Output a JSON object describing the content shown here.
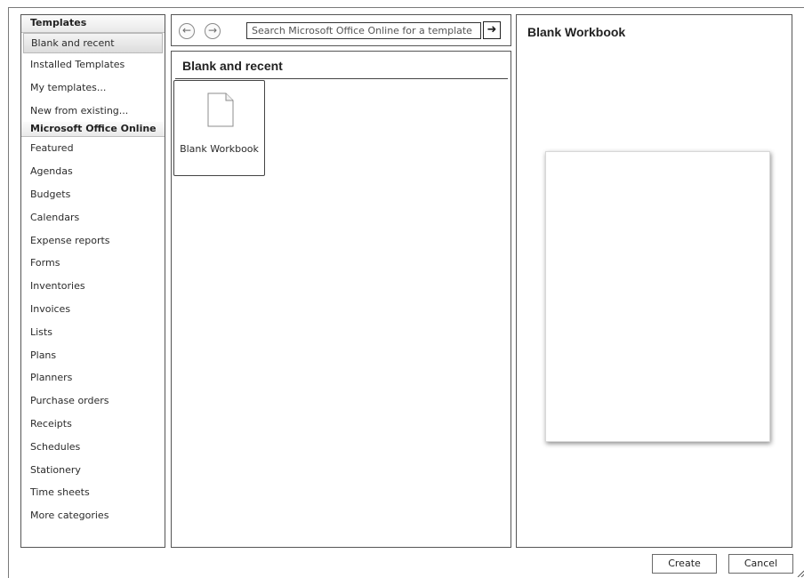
{
  "sidebar": {
    "header_templates": "Templates",
    "header_online": "Microsoft Office Online",
    "local_items": [
      "Blank and recent",
      "Installed Templates",
      "My templates...",
      "New from existing..."
    ],
    "online_items": [
      "Featured",
      "Agendas",
      "Budgets",
      "Calendars",
      "Expense reports",
      "Forms",
      "Inventories",
      "Invoices",
      "Lists",
      "Plans",
      "Planners",
      "Purchase orders",
      "Receipts",
      "Schedules",
      "Stationery",
      "Time sheets",
      "More categories"
    ]
  },
  "search": {
    "placeholder": "Search Microsoft Office Online for a template",
    "go_icon": "arrow-right-icon",
    "back_icon": "back-arrow-icon",
    "forward_icon": "forward-arrow-icon"
  },
  "middle": {
    "section_title": "Blank and recent",
    "tile_label": "Blank Workbook",
    "tile_icon": "blank-document-icon"
  },
  "preview": {
    "title": "Blank Workbook"
  },
  "buttons": {
    "create": "Create",
    "cancel": "Cancel"
  }
}
